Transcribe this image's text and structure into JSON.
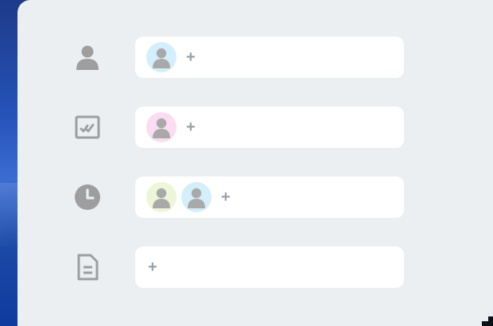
{
  "colors": {
    "icon_gray": "#9e9e9e",
    "avatar_figure": "#a9a9a9",
    "avatar_blue": "#d3effb",
    "avatar_pink": "#fbdcf1",
    "avatar_green": "#eef5d9",
    "field_bg": "#ffffff",
    "sheet_bg": "#ebeff2"
  },
  "rows": [
    {
      "icon": "person-icon",
      "avatars": [
        "blue"
      ],
      "add_label": "+"
    },
    {
      "icon": "approval-checks-icon",
      "avatars": [
        "pink"
      ],
      "add_label": "+"
    },
    {
      "icon": "clock-icon",
      "avatars": [
        "green",
        "blue"
      ],
      "add_label": "+"
    },
    {
      "icon": "document-icon",
      "avatars": [],
      "add_label": "+"
    }
  ]
}
